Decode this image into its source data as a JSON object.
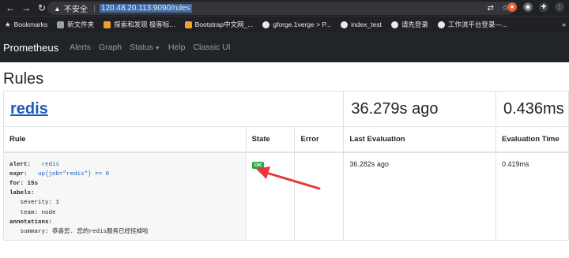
{
  "browser": {
    "security_label": "不安全",
    "url": "120.48.20.113:9090/rules",
    "bookmarks": [
      {
        "label": "Bookmarks",
        "icon": "star-icon"
      },
      {
        "label": "新文件夹",
        "icon": "folder-icon"
      },
      {
        "label": "探索和发现 极客标...",
        "icon": "image-icon"
      },
      {
        "label": "Bootstrap中文网_...",
        "icon": "image-icon"
      },
      {
        "label": "gforge.1verge > P...",
        "icon": "github-icon"
      },
      {
        "label": "index_test",
        "icon": "github-icon"
      },
      {
        "label": "请先登录",
        "icon": "github-icon"
      },
      {
        "label": "工作流平台登录—...",
        "icon": "github-icon"
      }
    ]
  },
  "nav": {
    "brand": "Prometheus",
    "links": [
      "Alerts",
      "Graph",
      "Status",
      "Help",
      "Classic UI"
    ]
  },
  "page": {
    "title": "Rules"
  },
  "group": {
    "name": "redis",
    "last_evaluation": "36.279s ago",
    "evaluation_time": "0.436ms"
  },
  "table": {
    "headers": [
      "Rule",
      "State",
      "Error",
      "Last Evaluation",
      "Evaluation Time"
    ]
  },
  "rule": {
    "alert_key": "alert:",
    "alert_value": "redis",
    "expr_key": "expr:",
    "expr_value": "up{job=\"redis\"} == 0",
    "for_line": "for: 15s",
    "labels_key": "labels:",
    "label_severity": "severity: 1",
    "label_team": "team: node",
    "annotations_key": "annotations:",
    "summary": "summary: 恭喜您. 您的redis服务已经挂掉啦",
    "state": "OK",
    "error": "",
    "last_evaluation": "36.282s ago",
    "evaluation_time": "0.419ms"
  },
  "colors": {
    "navbar_bg": "#212529",
    "link_blue": "#1a5cb8",
    "ok_badge": "#28a745",
    "annotation_arrow": "#e8363a"
  }
}
